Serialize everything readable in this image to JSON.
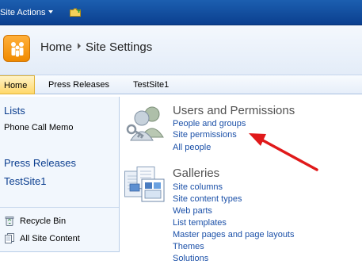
{
  "topbar": {
    "site_actions_label": "Site Actions",
    "background_color": "#0b3f8f",
    "folder_icon": "folder-up-icon"
  },
  "title_area": {
    "breadcrumb": [
      "Home",
      "Site Settings"
    ],
    "logo_icon": "sharepoint-people-logo",
    "logo_color": "#f08a00"
  },
  "top_nav": {
    "tabs": [
      {
        "label": "Home",
        "selected": true
      },
      {
        "label": "Press Releases",
        "selected": false
      },
      {
        "label": "TestSite1",
        "selected": false
      }
    ],
    "selected_color": "#ffd86a"
  },
  "left_nav": {
    "lists_heading": "Lists",
    "list_items": [
      "Phone Call Memo"
    ],
    "press_releases_heading": "Press Releases",
    "testsite_heading": "TestSite1",
    "utilities": [
      {
        "label": "Recycle Bin",
        "icon": "recycle-bin-icon"
      },
      {
        "label": "All Site Content",
        "icon": "all-site-content-icon"
      }
    ]
  },
  "main": {
    "sections": [
      {
        "title": "Users and Permissions",
        "icon": "users-permissions-icon",
        "links": [
          "People and groups",
          "Site permissions",
          "All people"
        ]
      },
      {
        "title": "Galleries",
        "icon": "galleries-icon",
        "links": [
          "Site columns",
          "Site content types",
          "Web parts",
          "List templates",
          "Master pages and page layouts",
          "Themes",
          "Solutions"
        ]
      }
    ],
    "link_color": "#1b50a8",
    "annotation_arrow_color": "#e0191a"
  }
}
